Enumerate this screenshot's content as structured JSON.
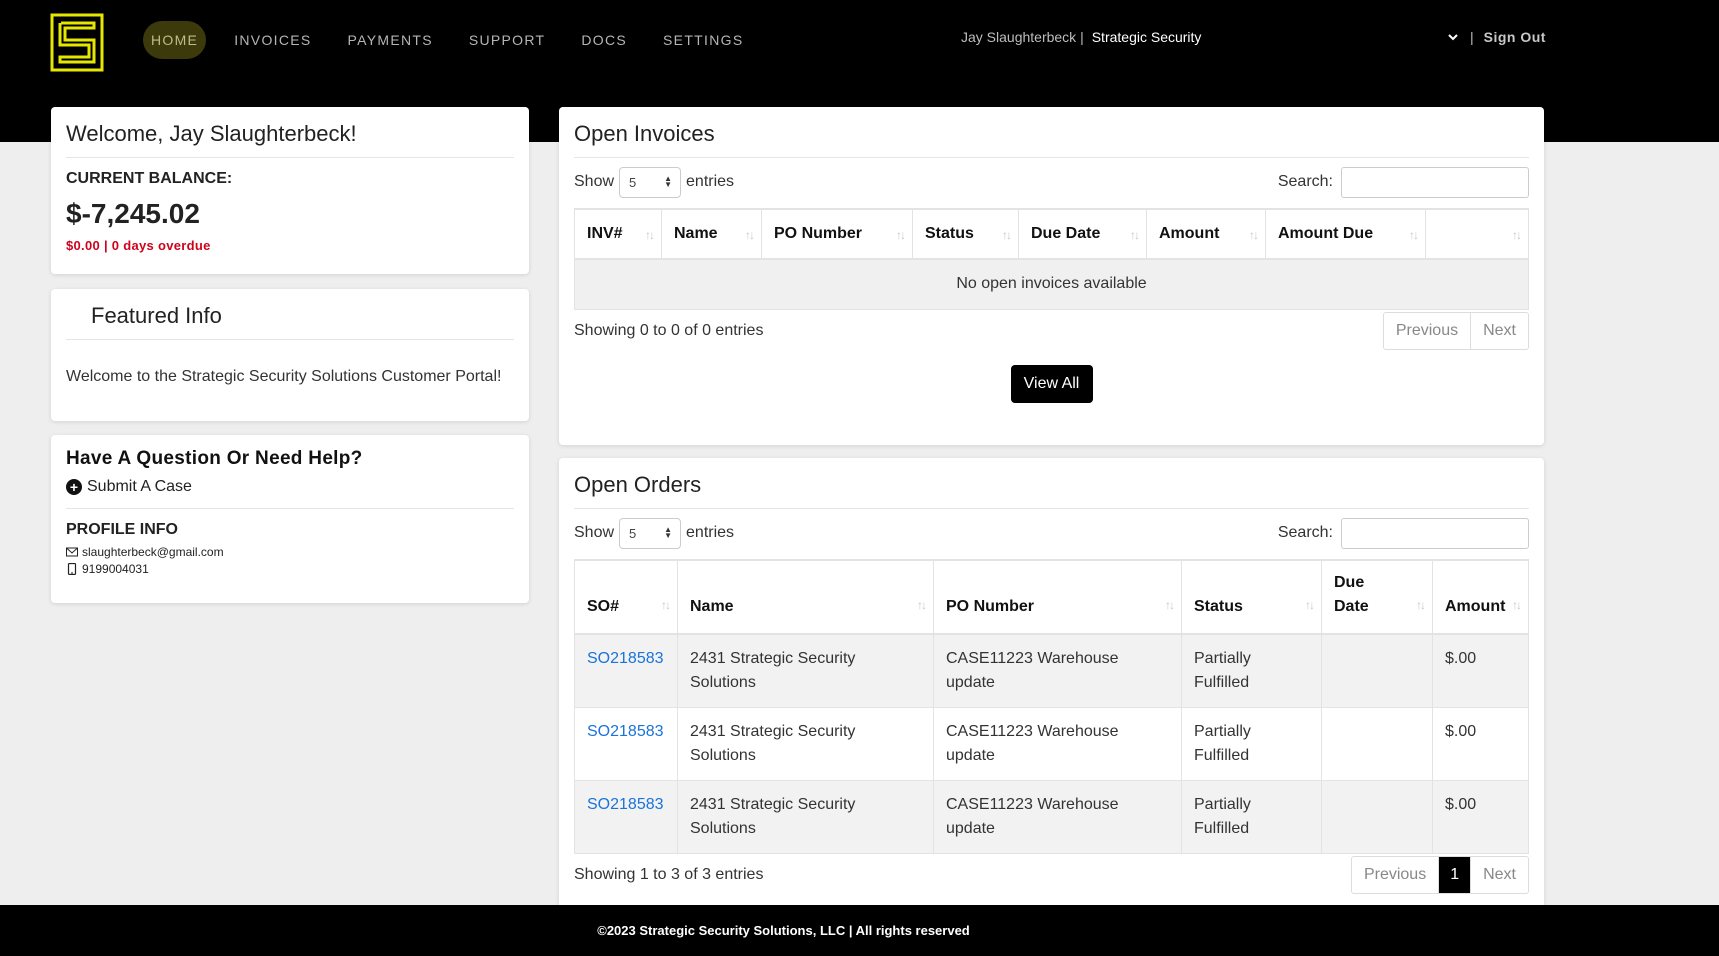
{
  "colors": {
    "topbar": "#000000",
    "accent_yellow": "#e6e600",
    "link": "#1a73d9",
    "overdue": "#d0021b"
  },
  "nav": {
    "logo_icon": "s-logo-icon",
    "items": [
      {
        "label": "HOME",
        "active": true
      },
      {
        "label": "INVOICES",
        "active": false
      },
      {
        "label": "PAYMENTS",
        "active": false
      },
      {
        "label": "SUPPORT",
        "active": false
      },
      {
        "label": "DOCS",
        "active": false
      },
      {
        "label": "SETTINGS",
        "active": false
      }
    ],
    "user_name": "Jay Slaughterbeck |",
    "company": "Strategic Security",
    "separator": "|",
    "sign_out": "Sign Out"
  },
  "welcome": {
    "title": "Welcome, Jay Slaughterbeck!",
    "balance_label": "CURRENT BALANCE:",
    "balance_value": "$-7,245.02",
    "overdue": "$0.00 | 0 days overdue"
  },
  "featured": {
    "title": "Featured Info",
    "text": "Welcome to the Strategic Security Solutions Customer Portal!"
  },
  "help": {
    "title": "Have A Question Or Need Help?",
    "submit_case": "Submit A Case",
    "profile_title": "PROFILE INFO",
    "email": "slaughterbeck@gmail.com",
    "phone": "9199004031"
  },
  "invoices": {
    "title": "Open Invoices",
    "show": "Show",
    "page_size": "5",
    "entries": "entries",
    "search_label": "Search:",
    "columns": [
      "INV#",
      "Name",
      "PO Number",
      "Status",
      "Due Date",
      "Amount",
      "Amount Due",
      ""
    ],
    "empty_text": "No open invoices available",
    "info": "Showing 0 to 0 of 0 entries",
    "prev": "Previous",
    "next": "Next",
    "view_all": "View All"
  },
  "orders": {
    "title": "Open Orders",
    "show": "Show",
    "page_size": "5",
    "entries": "entries",
    "search_label": "Search:",
    "columns": [
      "SO#",
      "Name",
      "PO Number",
      "Status",
      "Due Date",
      "Amount"
    ],
    "rows": [
      {
        "so": "SO218583",
        "name": "2431 Strategic Security Solutions",
        "po": "CASE11223 Warehouse update",
        "status": "Partially Fulfilled",
        "due": "",
        "amount": "$.00"
      },
      {
        "so": "SO218583",
        "name": "2431 Strategic Security Solutions",
        "po": "CASE11223 Warehouse update",
        "status": "Partially Fulfilled",
        "due": "",
        "amount": "$.00"
      },
      {
        "so": "SO218583",
        "name": "2431 Strategic Security Solutions",
        "po": "CASE11223 Warehouse update",
        "status": "Partially Fulfilled",
        "due": "",
        "amount": "$.00"
      }
    ],
    "info": "Showing 1 to 3 of 3 entries",
    "prev": "Previous",
    "current_page": "1",
    "next": "Next"
  },
  "footer": {
    "text": "©2023 Strategic Security Solutions, LLC | All rights reserved"
  }
}
